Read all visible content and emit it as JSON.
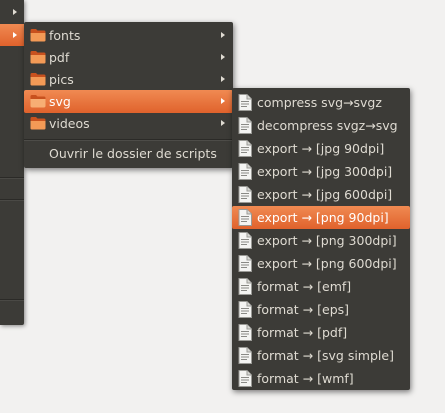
{
  "folder_menu": {
    "items": [
      {
        "label": "fonts",
        "icon": "folder-icon",
        "has_submenu": true
      },
      {
        "label": "pdf",
        "icon": "folder-icon",
        "has_submenu": true
      },
      {
        "label": "pics",
        "icon": "folder-icon",
        "has_submenu": true
      },
      {
        "label": "svg",
        "icon": "folder-icon",
        "has_submenu": true,
        "highlighted": true
      },
      {
        "label": "videos",
        "icon": "folder-icon",
        "has_submenu": true
      }
    ],
    "open_folder_label": "Ouvrir le dossier de scripts"
  },
  "svg_menu": {
    "items": [
      {
        "label": "compress svg→svgz",
        "icon": "document-icon"
      },
      {
        "label": "decompress svgz→svg",
        "icon": "document-icon"
      },
      {
        "label": "export → [jpg 90dpi]",
        "icon": "document-icon"
      },
      {
        "label": "export → [jpg 300dpi]",
        "icon": "document-icon"
      },
      {
        "label": "export → [jpg 600dpi]",
        "icon": "document-icon"
      },
      {
        "label": "export → [png 90dpi]",
        "icon": "document-icon",
        "highlighted": true
      },
      {
        "label": "export → [png 300dpi]",
        "icon": "document-icon"
      },
      {
        "label": "export → [png 600dpi]",
        "icon": "document-icon"
      },
      {
        "label": "format → [emf]",
        "icon": "document-icon"
      },
      {
        "label": "format → [eps]",
        "icon": "document-icon"
      },
      {
        "label": "format → [pdf]",
        "icon": "document-icon"
      },
      {
        "label": "format → [svg simple]",
        "icon": "document-icon"
      },
      {
        "label": "format → [wmf]",
        "icon": "document-icon"
      }
    ]
  },
  "colors": {
    "menu_bg": "#3c3b37",
    "menu_text": "#dfdbd2",
    "highlight": "#e9683a",
    "page_bg": "#f2f1f0"
  }
}
